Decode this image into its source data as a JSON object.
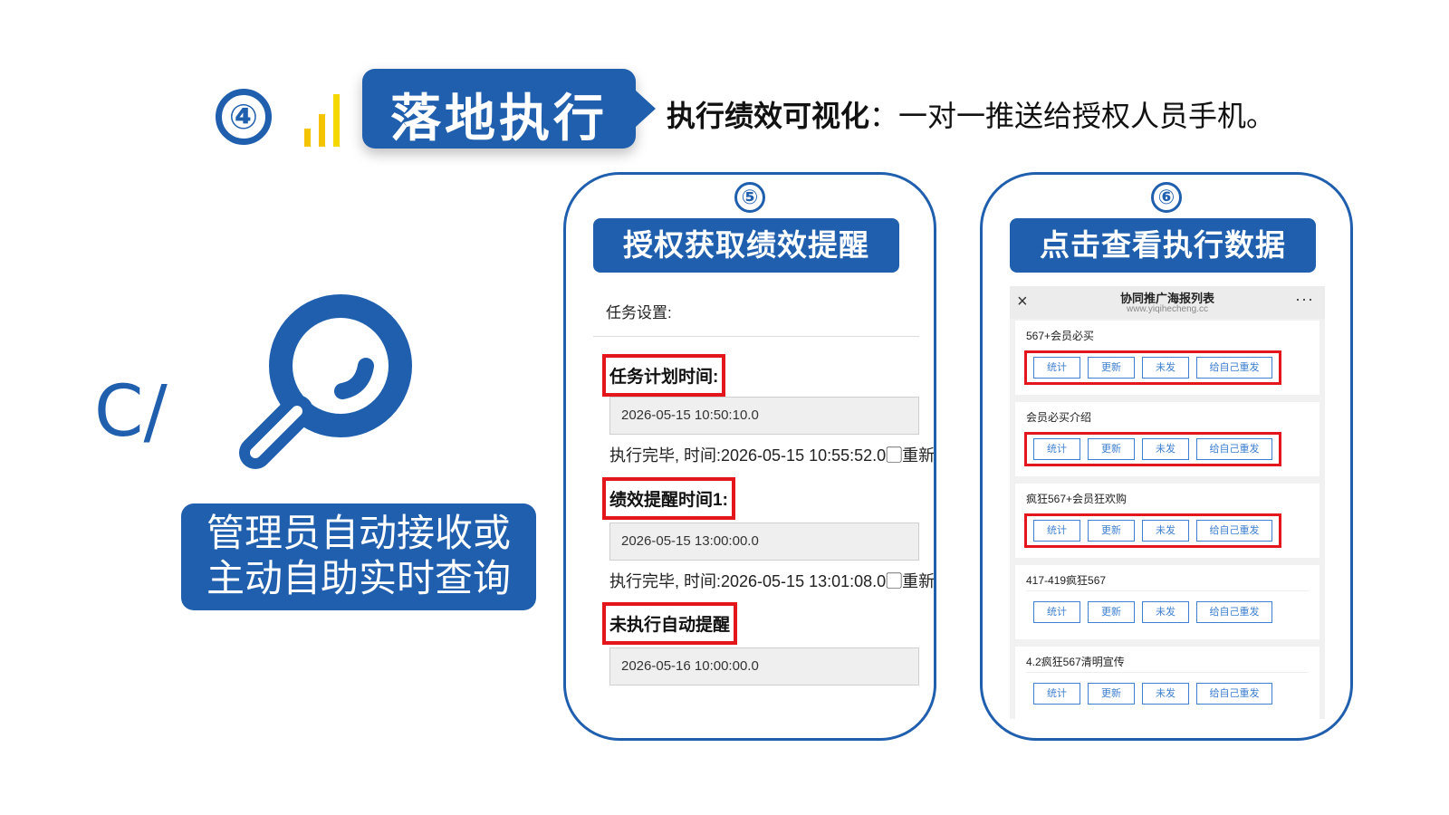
{
  "header": {
    "step_number": "④",
    "title": "落地执行",
    "headline_bold": "执行绩效可视化",
    "headline_rest": "：一对一推送给授权人员手机。"
  },
  "left": {
    "c_mark": "C/",
    "icon": "magnifier-icon",
    "admin_line1": "管理员自动接收或",
    "admin_line2": "主动自助实时查询"
  },
  "panel5": {
    "number": "⑤",
    "heading": "授权获取绩效提醒",
    "task_settings_label": "任务设置:",
    "sections": [
      {
        "label": "任务计划时间:",
        "value": "2026-05-15 10:50:10.0",
        "status": "执行完毕, 时间:2026-05-15 10:55:52.0",
        "restart": "重新启动"
      },
      {
        "label": "绩效提醒时间1:",
        "value": "2026-05-15 13:00:00.0",
        "status": "执行完毕, 时间:2026-05-15 13:01:08.0",
        "restart": "重新启动"
      },
      {
        "label": "未执行自动提醒",
        "value": "2026-05-16 10:00:00.0"
      }
    ]
  },
  "panel6": {
    "number": "⑥",
    "heading": "点击查看执行数据",
    "phone": {
      "close": "×",
      "title": "协同推广海报列表",
      "subtitle": "www.yiqihecheng.cc",
      "more": "···",
      "items": [
        {
          "title": "567+会员必买",
          "highlighted": true
        },
        {
          "title": "会员必买介绍",
          "highlighted": true
        },
        {
          "title": "疯狂567+会员狂欢购",
          "highlighted": true
        },
        {
          "title": "417-419疯狂567",
          "highlighted": false
        },
        {
          "title": "4.2疯狂567清明宣传",
          "highlighted": false
        }
      ],
      "buttons": [
        "统计",
        "更新",
        "未发",
        "给自己重发"
      ]
    }
  },
  "colors": {
    "brand_blue": "#1f5fae",
    "highlight_red": "#e3161c",
    "accent_yellow": "#f5c400",
    "link_blue": "#3d7fd0"
  }
}
